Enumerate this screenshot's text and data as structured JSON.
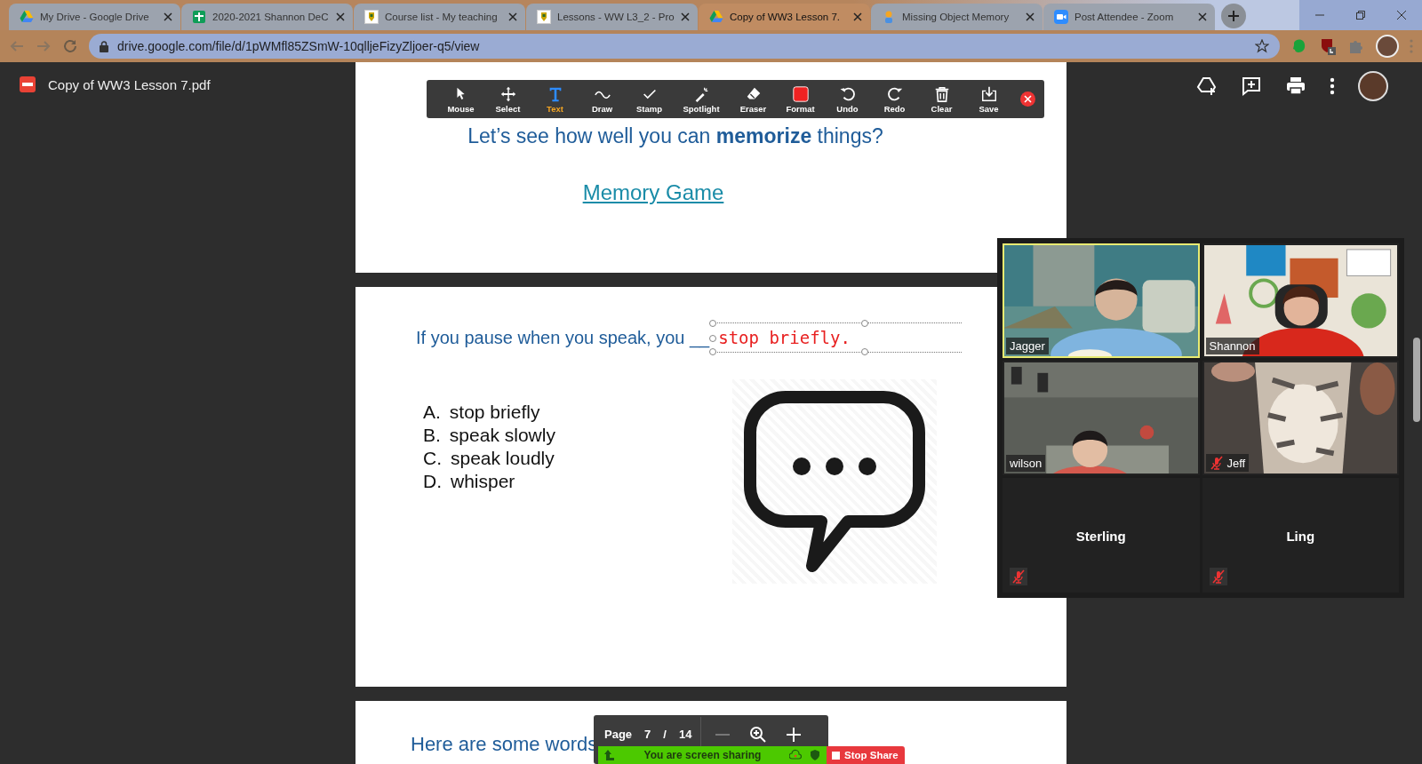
{
  "browser": {
    "tabs": [
      {
        "title": "My Drive - Google Drive",
        "selected": false
      },
      {
        "title": "2020-2021 Shannon DeC",
        "selected": false
      },
      {
        "title": "Course list - My teaching",
        "selected": false
      },
      {
        "title": "Lessons - WW L3_2 - Pro",
        "selected": false
      },
      {
        "title": "Copy of WW3 Lesson 7.",
        "selected": true
      },
      {
        "title": "Missing Object Memory",
        "selected": false
      },
      {
        "title": "Post Attendee - Zoom",
        "selected": false
      }
    ],
    "address": "drive.google.com/file/d/1pWMfl85ZSmW-10qlljeFizyZljoer-q5/view"
  },
  "viewer": {
    "file_name": "Copy of WW3 Lesson 7.pdf"
  },
  "annotation_toolbar": {
    "tools": [
      {
        "label": "Mouse",
        "selected": false
      },
      {
        "label": "Select",
        "selected": false
      },
      {
        "label": "Text",
        "selected": true
      },
      {
        "label": "Draw",
        "selected": false
      },
      {
        "label": "Stamp",
        "selected": false
      },
      {
        "label": "Spotlight",
        "selected": false
      },
      {
        "label": "Eraser",
        "selected": false
      },
      {
        "label": "Format",
        "selected": false
      },
      {
        "label": "Undo",
        "selected": false
      },
      {
        "label": "Redo",
        "selected": false
      },
      {
        "label": "Clear",
        "selected": false
      },
      {
        "label": "Save",
        "selected": false
      }
    ]
  },
  "slides": {
    "intro": {
      "prompt": "Let’s see how well you can **memorize** things?",
      "link": "Memory Game"
    },
    "question": {
      "prompt": "If you pause when you speak, you __",
      "annotation": "stop briefly.",
      "options": [
        {
          "letter": "A.",
          "text": "stop briefly"
        },
        {
          "letter": "B.",
          "text": "speak slowly"
        },
        {
          "letter": "C.",
          "text": "speak loudly"
        },
        {
          "letter": "D.",
          "text": "whisper"
        }
      ]
    },
    "advice": {
      "heading": "Here are some words"
    }
  },
  "page_controls": {
    "label": "Page",
    "current": "7",
    "separator": "/",
    "total": "14"
  },
  "sharing_bar": {
    "status": "You are screen sharing",
    "stop_button": "Stop Share"
  },
  "meeting": {
    "participants": [
      {
        "name": "Jagger",
        "kind": "video",
        "muted": false,
        "speaking": true
      },
      {
        "name": "Shannon",
        "kind": "video",
        "muted": false,
        "speaking": false
      },
      {
        "name": "wilson",
        "kind": "video",
        "muted": false,
        "speaking": false
      },
      {
        "name": "Jeff",
        "kind": "video",
        "muted": true,
        "speaking": false
      },
      {
        "name": "Sterling",
        "kind": "name_only",
        "muted": true,
        "speaking": false
      },
      {
        "name": "Ling",
        "kind": "name_only",
        "muted": true,
        "speaking": false
      }
    ]
  }
}
